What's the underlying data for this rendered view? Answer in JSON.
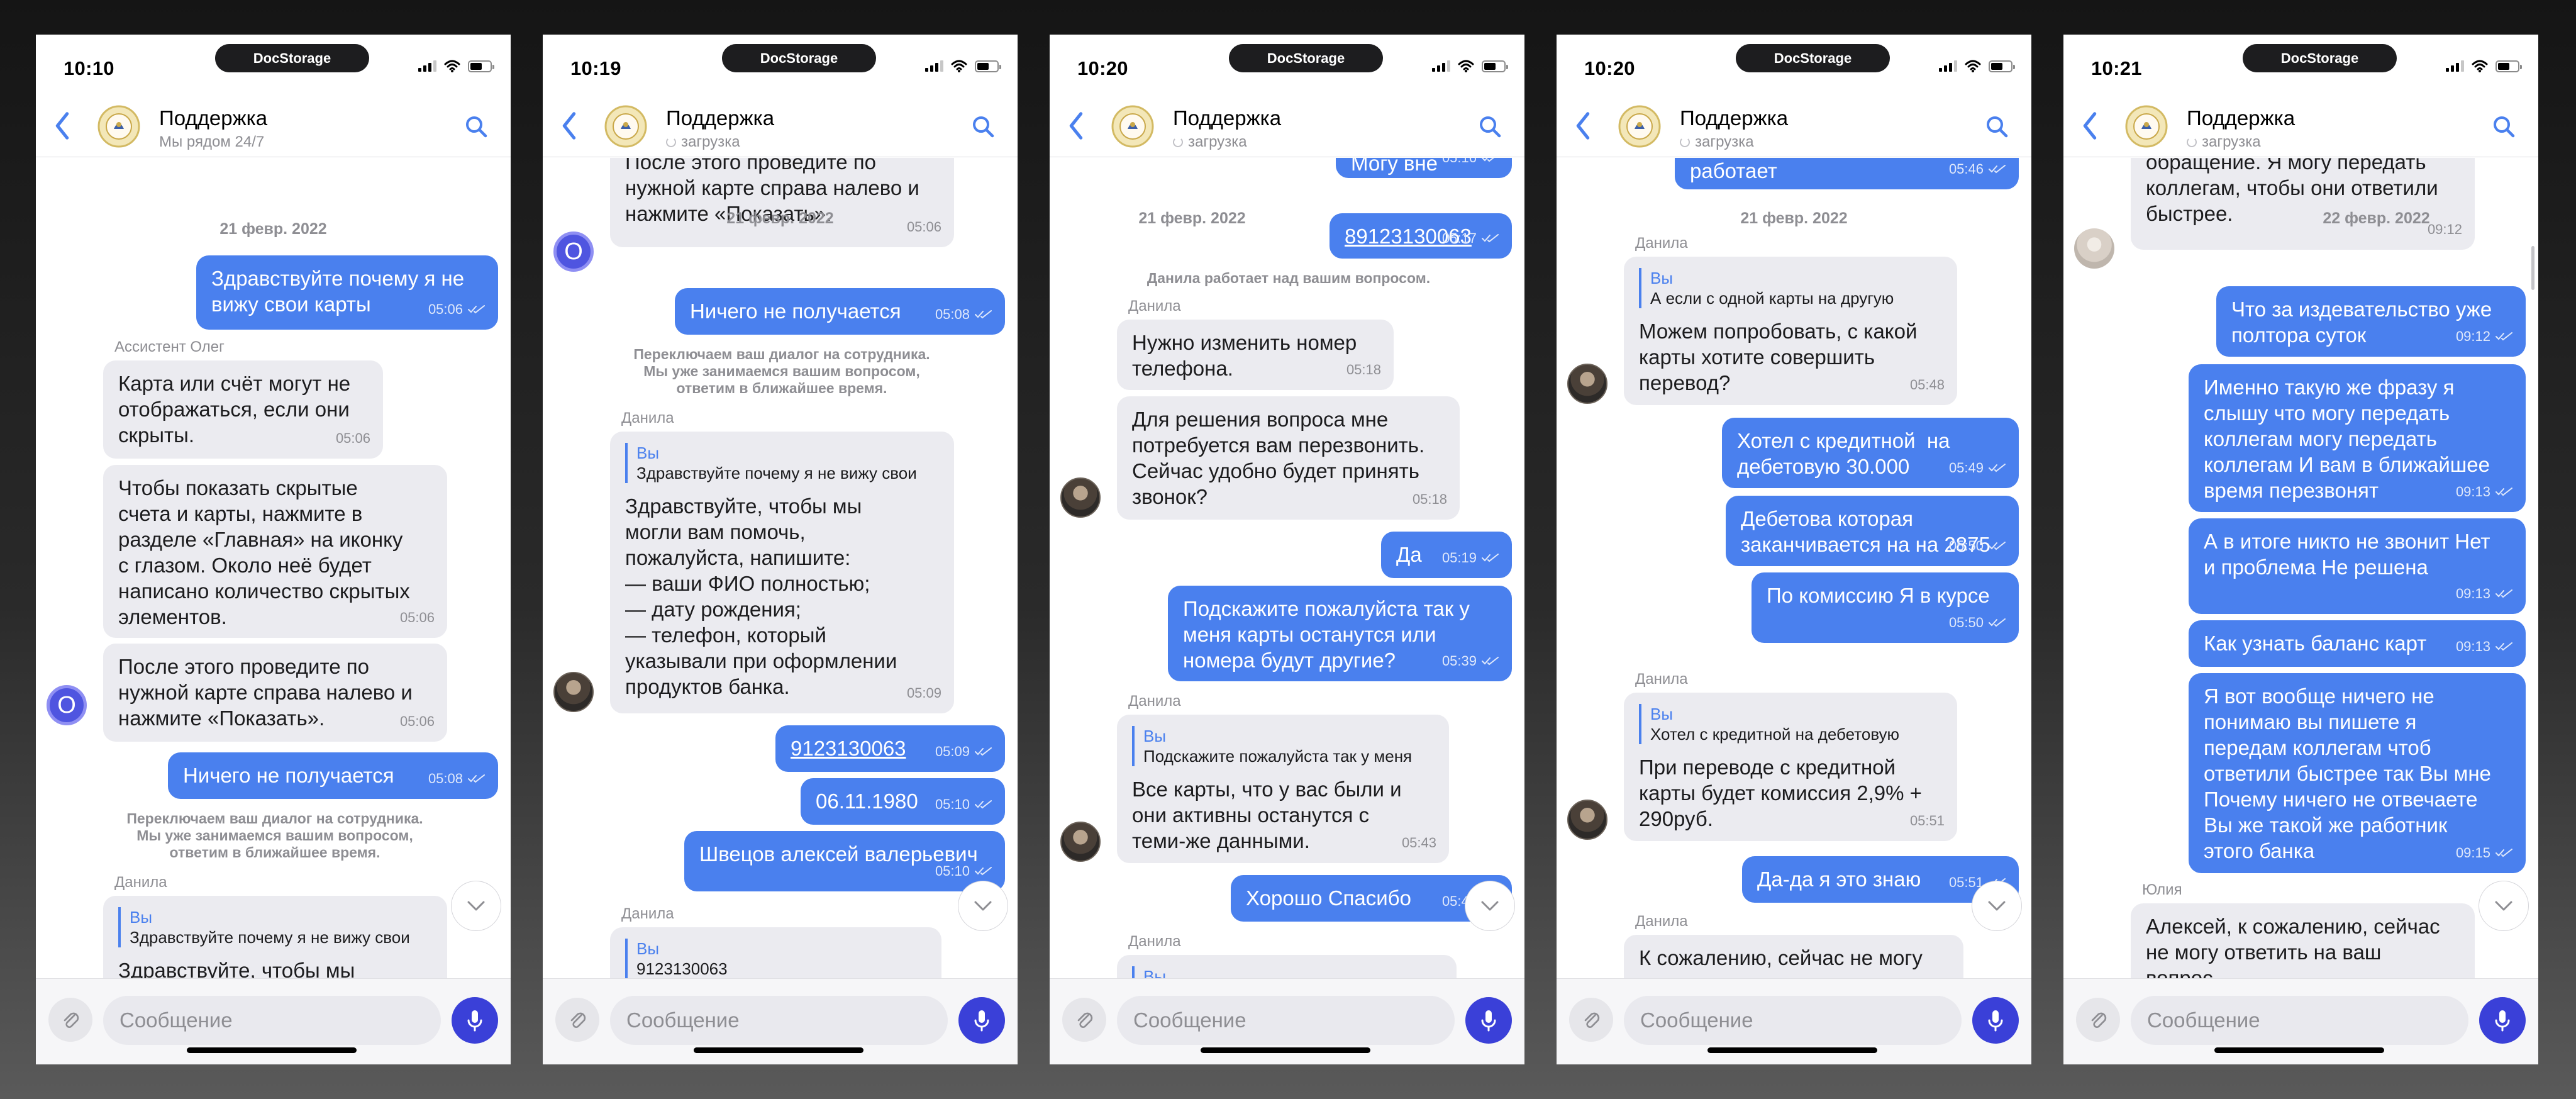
{
  "brand": "DocStorage",
  "colors": {
    "accent": "#4a80ee",
    "incoming": "#ebebf0",
    "mic": "#3a40d8"
  },
  "common": {
    "title": "Поддержка",
    "placeholder": "Сообщение",
    "loading": "загрузка",
    "date": "21 февр. 2022",
    "date_alt": "22 февр. 2022",
    "system_transfer": "Переключаем ваш диалог на сотрудника.\nМы уже занимаемся вашим вопросом,\nответим в ближайшее время.",
    "system_working": "Данила работает над вашим вопросом.",
    "icons": [
      "back-chevron-icon",
      "search-icon",
      "paperclip-icon",
      "mic-icon",
      "chevron-down-icon",
      "read-check-icon"
    ]
  },
  "screens": [
    {
      "time": "10:10",
      "subtitle": "Мы рядом 24/7",
      "messages": [
        {
          "text": "Здравствуйте почему я не\nвижу свои карты",
          "time": "05:06"
        },
        {
          "sender": "Ассистент Олег",
          "text": "Карта или счёт могут не\nотображаться, если они\nскрыты.",
          "time": "05:06"
        },
        {
          "text": "Чтобы показать скрытые\nсчета и карты, нажмите в\nразделе «Главная» на иконку\nс глазом. Около неё будет\nнаписано количество скрытых\nэлементов.",
          "time": "05:06"
        },
        {
          "text": "После этого проведите по\nнужной карте справа налево и\nнажмите «Показать».",
          "time": "05:06"
        },
        {
          "text": "Ничего не получается",
          "time": "05:08"
        },
        {
          "sender": "Данила",
          "quote_from": "Вы",
          "quote": "Здравствуйте почему я не вижу свои",
          "text": "Здравствуйте, чтобы мы"
        }
      ]
    },
    {
      "time": "10:19",
      "messages": [
        {
          "text": "После этого проведите по\nнужной карте справа налево и\nнажмите «Показать».",
          "time": "05:06"
        },
        {
          "text": "Ничего не получается",
          "time": "05:08"
        },
        {
          "sender": "Данила",
          "quote_from": "Вы",
          "quote": "Здравствуйте почему я не вижу свои",
          "text": "Здравствуйте, чтобы мы\nмогли вам помочь,\nпожалуйста, напишите:\n— ваши ФИО полностью;\n— дату рождения;\n— телефон, который\nуказывали при оформлении\nпродуктов банка.",
          "time": "05:09"
        },
        {
          "text": "9123130063",
          "time": "05:09"
        },
        {
          "text": "06.11.1980",
          "time": "05:10"
        },
        {
          "text": "Швецов алексей валерьевич",
          "time": "05:10"
        },
        {
          "sender": "Данила",
          "quote_from": "Вы",
          "quote": "9123130063"
        }
      ]
    },
    {
      "time": "10:20",
      "messages": [
        {
          "text": "Могу вне",
          "time": "05:16"
        },
        {
          "text": "89123130063",
          "time": "05:17"
        },
        {
          "sender": "Данила",
          "text": "Нужно изменить номер\nтелефона.",
          "time": "05:18"
        },
        {
          "text": "Для решения вопроса мне\nпотребуется вам перезвонить.\nСейчас удобно будет принять\nзвонок?",
          "time": "05:18"
        },
        {
          "text": "Да",
          "time": "05:19"
        },
        {
          "text": "Подскажите пожалуйста так у\nменя карты останутся или\nномера будут другие?",
          "time": "05:39"
        },
        {
          "sender": "Данила",
          "quote_from": "Вы",
          "quote": "Подскажите пожалуйста так у меня",
          "text": "Все карты, что у вас были и\nони активны останутся с\nтеми-же данными.",
          "time": "05:43"
        },
        {
          "text": "Хорошо Спасибо",
          "time": "05:44"
        },
        {
          "sender": "Данила",
          "quote_from": "Вы"
        }
      ]
    },
    {
      "time": "10:20",
      "messages": [
        {
          "text": "работает",
          "time": "05:46"
        },
        {
          "sender": "Данила",
          "quote_from": "Вы",
          "quote": "А если с одной карты на другую",
          "text": "Можем попробовать, с какой\nкарты хотите совершить\nперевод?",
          "time": "05:48"
        },
        {
          "text": "Хотел с кредитной  на\nдебетовую 30.000",
          "time": "05:49"
        },
        {
          "text": "Дебетова которая\nзаканчивается на на 2875",
          "time": "05:50"
        },
        {
          "text": "По комиссию Я в курсе",
          "time": "05:50"
        },
        {
          "sender": "Данила",
          "quote_from": "Вы",
          "quote": "Хотел с кредитной на дебетовую",
          "text": "При переводе с кредитной\nкарты будет комиссия 2,9% +\n290руб.",
          "time": "05:51"
        },
        {
          "text": "Да-да я это знаю",
          "time": "05:51"
        },
        {
          "sender": "Данила",
          "text": "К сожалению, сейчас не могу"
        }
      ]
    },
    {
      "time": "10:21",
      "messages": [
        {
          "text": "обращение. Я могу передать\nколлегам, чтобы они ответили\nбыстрее.",
          "time": "09:12"
        },
        {
          "text": "Что за издевательство уже\nполтора суток",
          "time": "09:12"
        },
        {
          "text": "Именно такую же фразу я\nслышу что могу передать\nколлегам могу передать\nколлегам И вам в ближайшее\nвремя перезвонят",
          "time": "09:13"
        },
        {
          "text": "А в итоге никто не звонит Нет\nи проблема Не решена",
          "time": "09:13"
        },
        {
          "text": "Как узнать баланс карт",
          "time": "09:13"
        },
        {
          "text": "Я вот вообще ничего не\nпонимаю вы пишете я\nпередам коллегам чтоб\nответили быстрее так Вы мне\nПочему ничего не отвечаете\nВы же такой же работник\nэтого банка",
          "time": "09:15"
        },
        {
          "sender": "Юлия",
          "text": "Алексей, к сожалению, сейчас\nне могу ответить на ваш\nвопрос."
        }
      ]
    }
  ]
}
